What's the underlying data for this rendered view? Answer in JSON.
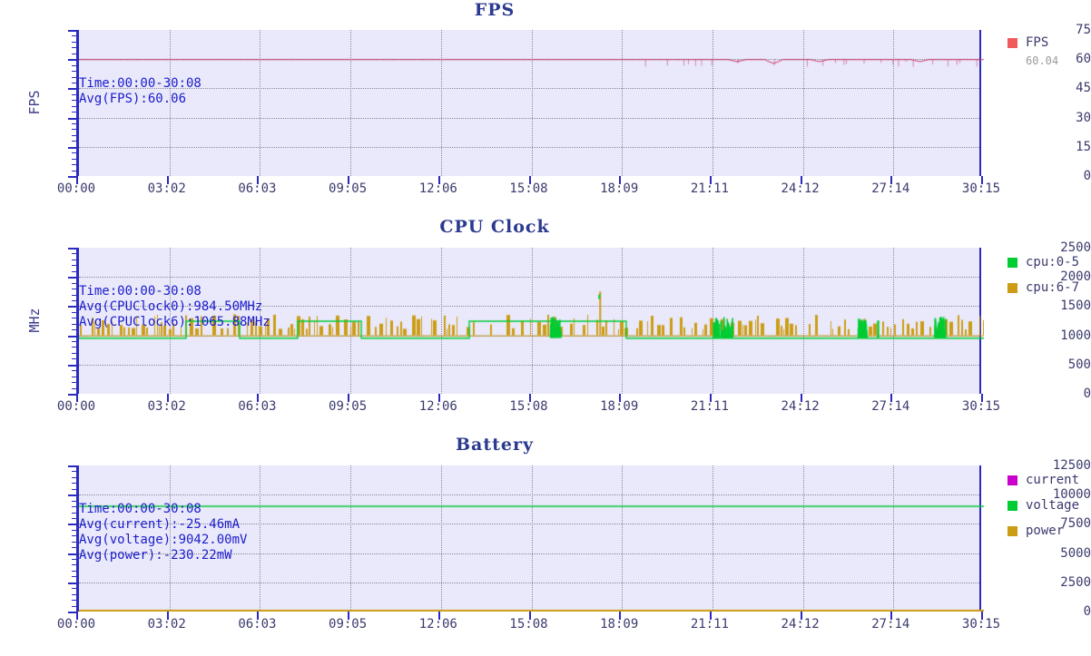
{
  "page": {
    "background": "#ffffff",
    "plot_background": "#e9e9fb",
    "axis_color": "#2a2ac0",
    "grid_color": "#8a8a9a",
    "title_color": "#2b3a8f",
    "annotation_color": "#1c1ccc"
  },
  "charts": [
    {
      "id": "fps",
      "title": "FPS",
      "ylabel": "FPS",
      "xlabel": "",
      "annotation": [
        "Time:00:00-30:08",
        "Avg(FPS):60.06"
      ],
      "yticks": [
        "0",
        "15",
        "30",
        "45",
        "60",
        "75"
      ],
      "xticks": [
        "00:00",
        "03:02",
        "06:03",
        "09:05",
        "12:06",
        "15:08",
        "18:09",
        "21:11",
        "24:12",
        "27:14",
        "30:15"
      ],
      "legend": [
        {
          "label": "FPS",
          "color": "#f05a5a",
          "value": "60.04"
        }
      ],
      "chart_data": {
        "type": "line",
        "title": "FPS",
        "xlabel": "",
        "ylabel": "FPS",
        "ylim": [
          0,
          75
        ],
        "xlim": [
          "00:00",
          "30:15"
        ],
        "grid": true,
        "legend_position": "right",
        "xticks": [
          "00:00",
          "03:02",
          "06:03",
          "09:05",
          "12:06",
          "15:08",
          "18:09",
          "21:11",
          "24:12",
          "27:14",
          "30:15"
        ],
        "yticks": [
          0,
          15,
          30,
          45,
          60,
          75
        ],
        "series": [
          {
            "name": "FPS",
            "color": "#cc3366",
            "average": 60.06,
            "last_value": 60.04,
            "values": [
              60,
              60,
              60,
              60,
              60,
              60,
              60,
              60,
              60,
              60,
              60,
              60,
              60,
              60,
              60,
              60,
              60,
              60,
              60,
              60,
              60,
              60,
              60,
              60,
              60,
              60,
              60,
              60,
              60,
              60,
              60,
              60,
              60,
              60,
              60,
              60,
              60,
              60,
              60,
              60,
              60,
              60,
              60,
              60,
              60,
              60,
              60,
              60,
              60,
              60,
              60,
              60,
              60,
              60,
              60,
              60,
              60,
              60,
              60,
              60,
              60,
              60,
              60,
              60,
              60,
              60,
              60,
              60,
              60,
              60,
              60,
              60,
              59,
              60,
              60,
              60,
              58,
              60,
              60,
              60,
              60,
              59,
              60,
              60,
              60,
              60,
              60,
              60,
              60,
              60,
              60,
              60,
              59,
              60,
              60,
              60,
              60,
              60,
              60,
              60
            ]
          }
        ]
      }
    },
    {
      "id": "cpu-clock",
      "title": "CPU Clock",
      "ylabel": "MHz",
      "xlabel": "",
      "annotation": [
        "Time:00:00-30:08",
        "Avg(CPUClock0):984.50MHz",
        "Avg(CPUClock6):1065.88MHz"
      ],
      "yticks": [
        "0",
        "500",
        "1000",
        "1500",
        "2000",
        "2500"
      ],
      "xticks": [
        "00:00",
        "03:02",
        "06:03",
        "09:05",
        "12:06",
        "15:08",
        "18:09",
        "21:11",
        "24:12",
        "27:14",
        "30:15"
      ],
      "legend": [
        {
          "label": "cpu:0-5",
          "color": "#00cc33",
          "value": ""
        },
        {
          "label": "cpu:6-7",
          "color": "#cc9c14",
          "value": ""
        }
      ],
      "chart_data": {
        "type": "line",
        "title": "CPU Clock",
        "xlabel": "",
        "ylabel": "MHz",
        "ylim": [
          0,
          2500
        ],
        "xlim": [
          "00:00",
          "30:15"
        ],
        "grid": true,
        "legend_position": "right",
        "xticks": [
          "00:00",
          "03:02",
          "06:03",
          "09:05",
          "12:06",
          "15:08",
          "18:09",
          "21:11",
          "24:12",
          "27:14",
          "30:15"
        ],
        "yticks": [
          0,
          500,
          1000,
          1500,
          2000,
          2500
        ],
        "series": [
          {
            "name": "cpu:0-5",
            "color": "#00cc33",
            "average_mhz": 984.5,
            "baseline_mhz": 960,
            "spike_mhz": 1250,
            "max_spike_mhz": 1700
          },
          {
            "name": "cpu:6-7",
            "color": "#cc9c14",
            "average_mhz": 1065.88,
            "baseline_mhz": 1000,
            "spike_mhz": 1200,
            "max_spike_mhz": 1750
          }
        ]
      }
    },
    {
      "id": "battery",
      "title": "Battery",
      "ylabel": "",
      "xlabel": "",
      "annotation": [
        "Time:00:00-30:08",
        "Avg(current):-25.46mA",
        "Avg(voltage):9042.00mV",
        "Avg(power):-230.22mW"
      ],
      "yticks": [
        "0",
        "2500",
        "5000",
        "7500",
        "10000",
        "12500"
      ],
      "xticks": [
        "00:00",
        "03:02",
        "06:03",
        "09:05",
        "12:06",
        "15:08",
        "18:09",
        "21:11",
        "24:12",
        "27:14",
        "30:15"
      ],
      "legend": [
        {
          "label": "current",
          "color": "#cc00cc",
          "value": ""
        },
        {
          "label": "voltage",
          "color": "#00cc33",
          "value": ""
        },
        {
          "label": "power",
          "color": "#cc9c14",
          "value": ""
        }
      ],
      "chart_data": {
        "type": "line",
        "title": "Battery",
        "xlabel": "",
        "ylabel": "",
        "ylim": [
          0,
          12500
        ],
        "xlim": [
          "00:00",
          "30:15"
        ],
        "grid": true,
        "legend_position": "right",
        "xticks": [
          "00:00",
          "03:02",
          "06:03",
          "09:05",
          "12:06",
          "15:08",
          "18:09",
          "21:11",
          "24:12",
          "27:14",
          "30:15"
        ],
        "yticks": [
          0,
          2500,
          5000,
          7500,
          10000,
          12500
        ],
        "series": [
          {
            "name": "current",
            "color": "#cc00cc",
            "average": -25.46,
            "unit": "mA",
            "constant_value": 0
          },
          {
            "name": "voltage",
            "color": "#00cc33",
            "average": 9042.0,
            "unit": "mV",
            "constant_value": 9042
          },
          {
            "name": "power",
            "color": "#cc9c14",
            "average": -230.22,
            "unit": "mW",
            "constant_value": 0
          }
        ]
      }
    }
  ]
}
